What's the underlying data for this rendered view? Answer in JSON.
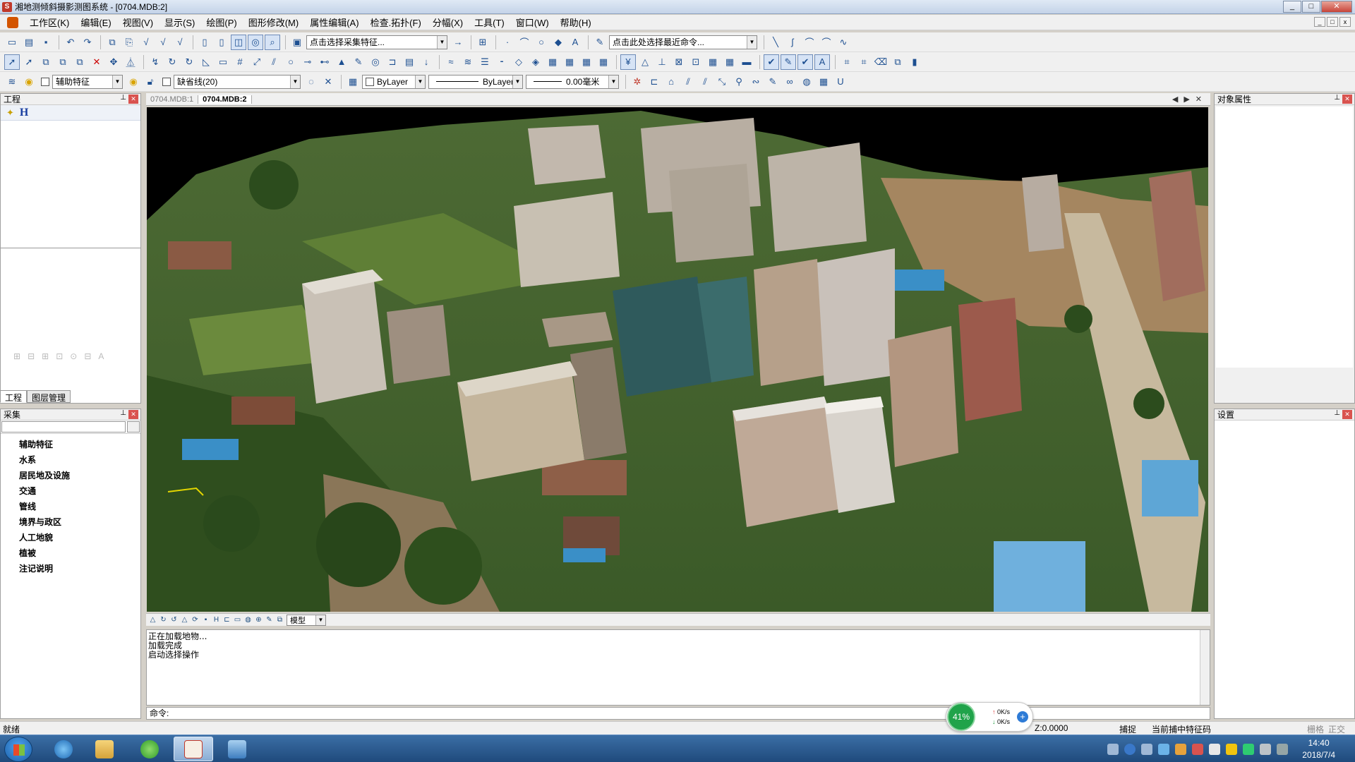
{
  "window": {
    "title": "湘地测倾斜摄影测图系统 - [0704.MDB:2]",
    "minimize": "_",
    "restore": "□",
    "close": "✕"
  },
  "menu": [
    "工作区(K)",
    "编辑(E)",
    "视图(V)",
    "显示(S)",
    "绘图(P)",
    "图形修改(M)",
    "属性编辑(A)",
    "检查.拓扑(F)",
    "分幅(X)",
    "工具(T)",
    "窗口(W)",
    "帮助(H)"
  ],
  "toolbar1": {
    "collect_feature_placeholder": "点击选择采集特征...",
    "recent_command_placeholder": "点击此处选择最近命令..."
  },
  "toolbar3": {
    "layer": "辅助特征",
    "linetype_layer": "缺省线(20)",
    "color": "ByLayer",
    "linetype": "ByLayer",
    "lineweight": "0.00毫米"
  },
  "left": {
    "project_panel_title": "工程",
    "project_root": "H",
    "tab_project": "工程",
    "tab_layers": "图层管理",
    "collect_panel_title": "采集",
    "categories": [
      "辅助特征",
      "水系",
      "居民地及设施",
      "交通",
      "管线",
      "境界与政区",
      "人工地貌",
      "植被",
      "注记说明"
    ]
  },
  "doc_tabs": [
    "0704.MDB:1",
    "0704.MDB:2"
  ],
  "active_doc": "0704.MDB:2",
  "view_mode": "模型",
  "console_lines": [
    "正在加载地物...",
    "加载完成",
    "启动选择操作"
  ],
  "command_prompt": "命令:",
  "right": {
    "props_title": "对象属性",
    "settings_title": "设置"
  },
  "status": {
    "ready": "就绪",
    "coord": "Z:0.0000",
    "snap": "捕捉",
    "current_code": "当前捕中特征码",
    "grid": "栅格",
    "ortho": "正交"
  },
  "net": {
    "percent": "41%",
    "up": "0K/s",
    "down": "0K/s"
  },
  "clock": {
    "time": "14:40",
    "date": "2018/7/4"
  },
  "colors": {
    "titlebar": "#c4d3e8",
    "sky": "#000000",
    "net_green": "#20a34a"
  }
}
